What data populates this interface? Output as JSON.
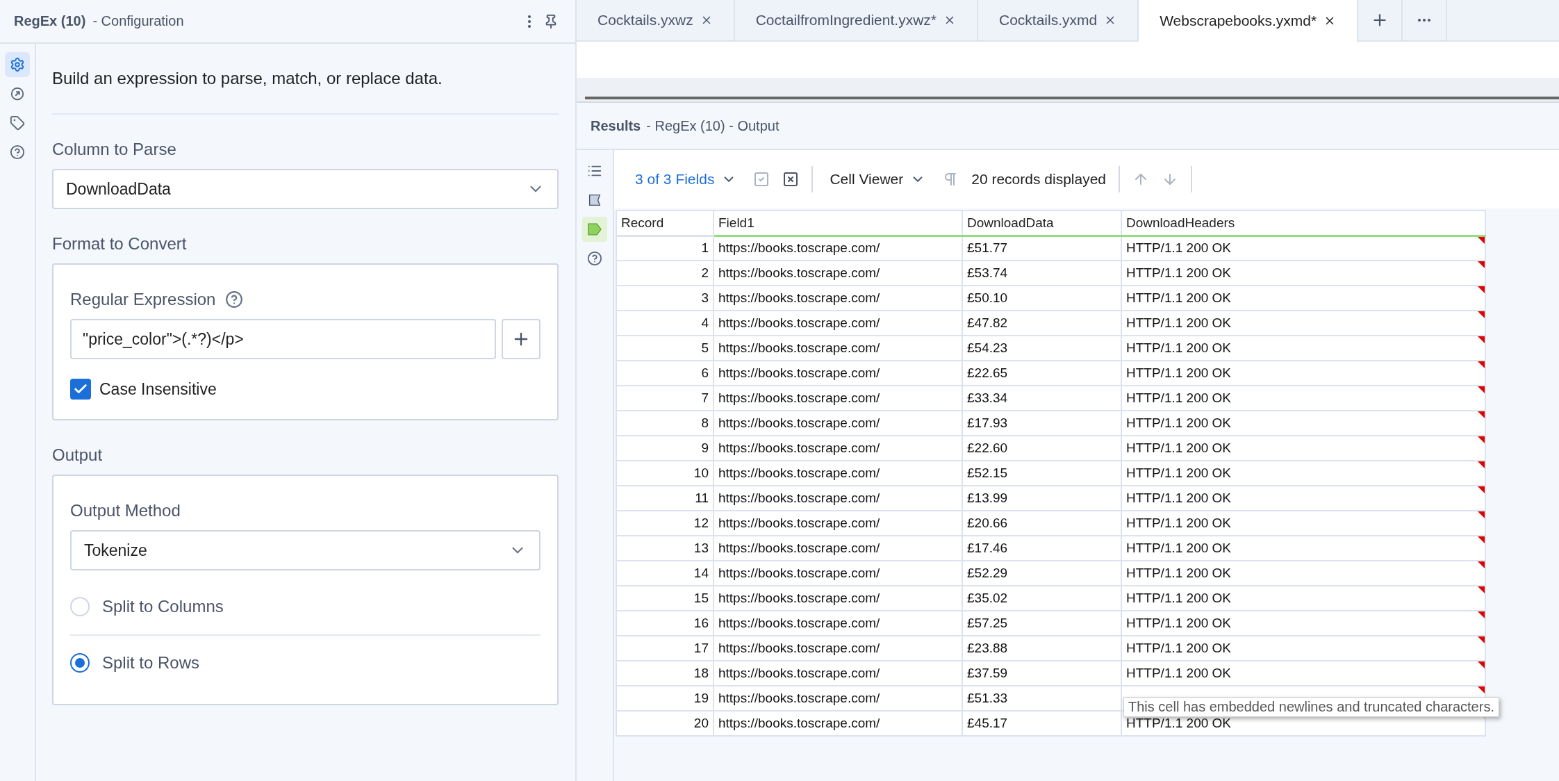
{
  "config": {
    "title": "RegEx (10)",
    "subtitle": "- Configuration",
    "rail": [
      {
        "kind": "gear",
        "selected": true
      },
      {
        "kind": "arrow",
        "selected": false
      },
      {
        "kind": "tag",
        "selected": false
      },
      {
        "kind": "help",
        "selected": false
      }
    ],
    "description": "Build an expression to parse, match, or replace data.",
    "column_label": "Column to Parse",
    "column_value": "DownloadData",
    "format_label": "Format to Convert",
    "regex_label": "Regular Expression",
    "regex_value": "\"price_color\">(.*?)</p>",
    "case_insensitive": {
      "label": "Case Insensitive",
      "checked": true
    },
    "output_label": "Output",
    "method_label": "Output Method",
    "method_value": "Tokenize",
    "options": [
      {
        "label": "Split to Columns",
        "selected": false
      },
      {
        "label": "Split to Rows",
        "selected": true
      }
    ]
  },
  "tabs": [
    {
      "label": "Cocktails.yxwz",
      "selected": false
    },
    {
      "label": "CoctailfromIngredient.yxwz*",
      "selected": false
    },
    {
      "label": "Cocktails.yxmd",
      "selected": false
    },
    {
      "label": "Webscrapebooks.yxmd*",
      "selected": true
    }
  ],
  "results": {
    "title": "Results",
    "subtitle": "- RegEx (10) - Output",
    "rail": [
      {
        "kind": "list",
        "selected": false
      },
      {
        "kind": "table",
        "selected": false
      },
      {
        "kind": "tag",
        "selected": true
      },
      {
        "kind": "help",
        "selected": false
      }
    ],
    "fields": "3 of 3 Fields",
    "viewer": "Cell Viewer",
    "records": "20 records displayed",
    "columns": [
      {
        "label": "Record",
        "highlighted": false
      },
      {
        "label": "Field1",
        "highlighted": true
      },
      {
        "label": "DownloadData",
        "highlighted": true
      },
      {
        "label": "DownloadHeaders",
        "highlighted": true
      }
    ],
    "rows": [
      {
        "record": "1",
        "field1": "https://books.toscrape.com/",
        "download_data": "£51.77",
        "download_headers": "HTTP/1.1 200 OK",
        "truncated": true
      },
      {
        "record": "2",
        "field1": "https://books.toscrape.com/",
        "download_data": "£53.74",
        "download_headers": "HTTP/1.1 200 OK",
        "truncated": true
      },
      {
        "record": "3",
        "field1": "https://books.toscrape.com/",
        "download_data": "£50.10",
        "download_headers": "HTTP/1.1 200 OK",
        "truncated": true
      },
      {
        "record": "4",
        "field1": "https://books.toscrape.com/",
        "download_data": "£47.82",
        "download_headers": "HTTP/1.1 200 OK",
        "truncated": true
      },
      {
        "record": "5",
        "field1": "https://books.toscrape.com/",
        "download_data": "£54.23",
        "download_headers": "HTTP/1.1 200 OK",
        "truncated": true
      },
      {
        "record": "6",
        "field1": "https://books.toscrape.com/",
        "download_data": "£22.65",
        "download_headers": "HTTP/1.1 200 OK",
        "truncated": true
      },
      {
        "record": "7",
        "field1": "https://books.toscrape.com/",
        "download_data": "£33.34",
        "download_headers": "HTTP/1.1 200 OK",
        "truncated": true
      },
      {
        "record": "8",
        "field1": "https://books.toscrape.com/",
        "download_data": "£17.93",
        "download_headers": "HTTP/1.1 200 OK",
        "truncated": true
      },
      {
        "record": "9",
        "field1": "https://books.toscrape.com/",
        "download_data": "£22.60",
        "download_headers": "HTTP/1.1 200 OK",
        "truncated": true
      },
      {
        "record": "10",
        "field1": "https://books.toscrape.com/",
        "download_data": "£52.15",
        "download_headers": "HTTP/1.1 200 OK",
        "truncated": true
      },
      {
        "record": "11",
        "field1": "https://books.toscrape.com/",
        "download_data": "£13.99",
        "download_headers": "HTTP/1.1 200 OK",
        "truncated": true
      },
      {
        "record": "12",
        "field1": "https://books.toscrape.com/",
        "download_data": "£20.66",
        "download_headers": "HTTP/1.1 200 OK",
        "truncated": true
      },
      {
        "record": "13",
        "field1": "https://books.toscrape.com/",
        "download_data": "£17.46",
        "download_headers": "HTTP/1.1 200 OK",
        "truncated": true
      },
      {
        "record": "14",
        "field1": "https://books.toscrape.com/",
        "download_data": "£52.29",
        "download_headers": "HTTP/1.1 200 OK",
        "truncated": true
      },
      {
        "record": "15",
        "field1": "https://books.toscrape.com/",
        "download_data": "£35.02",
        "download_headers": "HTTP/1.1 200 OK",
        "truncated": true
      },
      {
        "record": "16",
        "field1": "https://books.toscrape.com/",
        "download_data": "£57.25",
        "download_headers": "HTTP/1.1 200 OK",
        "truncated": true
      },
      {
        "record": "17",
        "field1": "https://books.toscrape.com/",
        "download_data": "£23.88",
        "download_headers": "HTTP/1.1 200 OK",
        "truncated": true
      },
      {
        "record": "18",
        "field1": "https://books.toscrape.com/",
        "download_data": "£37.59",
        "download_headers": "HTTP/1.1 200 OK",
        "truncated": true
      },
      {
        "record": "19",
        "field1": "https://books.toscrape.com/",
        "download_data": "£51.33",
        "truncated": true
      },
      {
        "record": "20",
        "field1": "https://books.toscrape.com/",
        "download_data": "£45.17",
        "download_headers": "HTTP/1.1 200 OK",
        "truncated": false
      }
    ],
    "tooltip": "This cell has embedded newlines and truncated characters."
  }
}
